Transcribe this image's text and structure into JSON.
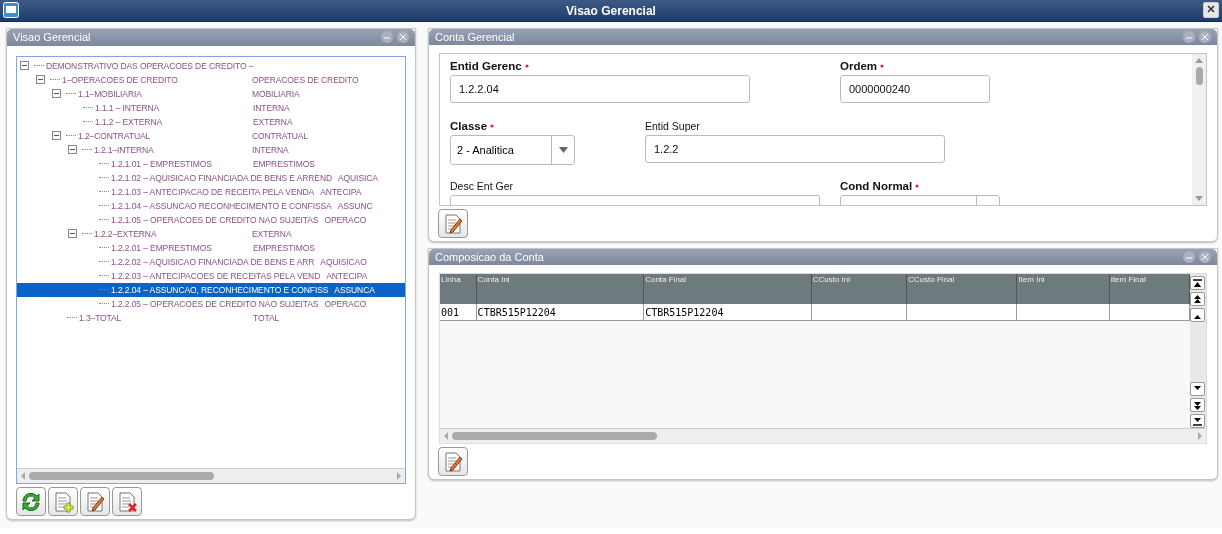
{
  "window": {
    "title": "Visao Gerencial"
  },
  "tree_panel": {
    "title": "Visao Gerencial",
    "tree": [
      {
        "code": "DEMONSTRATIVO DAS OPERACOES DE CREDITO –",
        "expanded": true,
        "selected": false,
        "children": [
          {
            "code": "1–OPERACOES DE CREDITO",
            "desc": "OPERACOES DE CREDITO",
            "expanded": true,
            "selected": false,
            "children": [
              {
                "code": "1.1–MOBILIARIA",
                "desc": "MOBILIARIA",
                "expanded": true,
                "selected": false,
                "children": [
                  {
                    "code": "1.1.1 – INTERNA",
                    "desc": "INTERNA",
                    "selected": false
                  },
                  {
                    "code": "1.1.2 – EXTERNA",
                    "desc": "EXTERNA",
                    "selected": false
                  }
                ]
              },
              {
                "code": "1.2–CONTRATUAL",
                "desc": "CONTRATUAL",
                "expanded": true,
                "selected": false,
                "children": [
                  {
                    "code": "1.2.1–INTERNA",
                    "desc": "INTERNA",
                    "expanded": true,
                    "selected": false,
                    "children": [
                      {
                        "code": "1.2.1.01 – EMPRESTIMOS",
                        "desc": "EMPRESTIMOS",
                        "selected": false
                      },
                      {
                        "code": "1.2.1.02 – AQUISICAO FINANCIADA DE BENS E ARREND",
                        "desc": "AQUISICA",
                        "selected": false
                      },
                      {
                        "code": "1.2.1.03 – ANTECIPACAO DE RECEITA PELA VENDA",
                        "desc": "ANTECIPA",
                        "selected": false
                      },
                      {
                        "code": "1.2.1.04 – ASSUNCAO RECONHECIMENTO E CONFISSA",
                        "desc": "ASSUNC",
                        "selected": false
                      },
                      {
                        "code": "1.2.1.05 – OPERACOES DE CREDITO NAO SUJEITAS",
                        "desc": "OPERACO",
                        "selected": false
                      }
                    ]
                  },
                  {
                    "code": "1.2.2–EXTERNA",
                    "desc": "EXTERNA",
                    "expanded": true,
                    "selected": false,
                    "children": [
                      {
                        "code": "1.2.2.01 – EMPRESTIMOS",
                        "desc": "EMPRESTIMOS",
                        "selected": false
                      },
                      {
                        "code": "1.2.2.02 – AQUISICAO FINANCIADA DE BENS E ARR",
                        "desc": "AQUISICAO",
                        "selected": false
                      },
                      {
                        "code": "1.2.2.03 – ANTECIPACOES DE RECEITAS PELA VEND",
                        "desc": "ANTECIPA",
                        "selected": false
                      },
                      {
                        "code": "1.2.2.04 – ASSUNCAO, RECONHECIMENTO E CONFISS",
                        "desc": "ASSUNCA",
                        "selected": true
                      },
                      {
                        "code": "1.2.2.05 – OPERACOES DE CREDITO NAO SUJEITAS",
                        "desc": "OPERACO",
                        "selected": false
                      }
                    ]
                  }
                ]
              },
              {
                "code": "1.3–TOTAL",
                "desc": "TOTAL",
                "selected": false
              }
            ]
          }
        ]
      }
    ]
  },
  "form_panel": {
    "title": "Conta Gerencial",
    "fields": [
      {
        "kind": "text",
        "label": "Entid Gerenc",
        "required": true,
        "bold": true,
        "value": "1.2.2.04"
      },
      {
        "kind": "text",
        "label": "Ordem",
        "required": true,
        "bold": true,
        "value": "0000000240"
      },
      {
        "kind": "select",
        "label": "Classe",
        "required": true,
        "bold": true,
        "value": "2 - Analitica"
      },
      {
        "kind": "text",
        "label": "Entid Super",
        "required": false,
        "bold": false,
        "value": "1.2.2"
      },
      {
        "kind": "text",
        "label": "Desc Ent Ger",
        "required": false,
        "bold": false
      },
      {
        "kind": "select",
        "label": "Cond Normal",
        "required": true,
        "bold": true
      }
    ]
  },
  "grid_panel": {
    "title": "Composicao da Conta",
    "columns": [
      "Linha",
      "Conta Ini",
      "Conta Final",
      "CCusto Ini",
      "CCusto Final",
      "Item Ini",
      "Item Final"
    ],
    "rows": [
      [
        "001",
        "CTBR515P12204",
        "CTBR515P12204",
        "",
        "",
        "",
        ""
      ]
    ]
  }
}
